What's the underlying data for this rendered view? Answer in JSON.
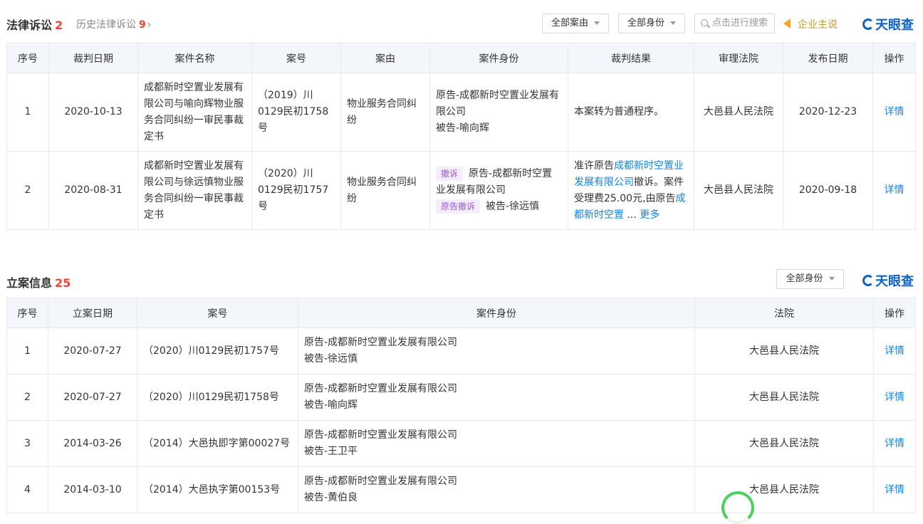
{
  "lawsuits": {
    "title": "法律诉讼",
    "count": "2",
    "history_label": "历史法律诉讼",
    "history_count": "9",
    "filter_cause": "全部案由",
    "filter_role": "全部身份",
    "search_placeholder": "点击进行搜索",
    "speak_label": "企业主说",
    "brand": "天眼查",
    "columns": [
      "序号",
      "裁判日期",
      "案件名称",
      "案号",
      "案由",
      "案件身份",
      "裁判结果",
      "审理法院",
      "发布日期",
      "操作"
    ],
    "rows": [
      {
        "no": "1",
        "date": "2020-10-13",
        "name": "成都新时空置业发展有限公司与喻向辉物业服务合同纠纷一审民事裁定书",
        "case_no": "（2019）川0129民初1758号",
        "cause": "物业服务合同纠纷",
        "role_line1": "原告-成都新时空置业发展有限公司",
        "role_line2": "被告-喻向辉",
        "result": "本案转为普通程序。",
        "court": "大邑县人民法院",
        "pub_date": "2020-12-23",
        "action": "详情"
      },
      {
        "no": "2",
        "date": "2020-08-31",
        "name": "成都新时空置业发展有限公司与徐远慎物业服务合同纠纷一审民事裁定书",
        "case_no": "（2020）川0129民初1757号",
        "cause": "物业服务合同纠纷",
        "tag1": "撤诉",
        "role_line1": "原告-成都新时空置业发展有限公司",
        "tag2": "原告撤诉",
        "role_line2": "被告-徐远慎",
        "result_pre": "准许原告",
        "result_link1": "成都新时空置业发展有限公司",
        "result_mid": "撤诉。案件受理费25.00元,由原告",
        "result_link2": "成都新时空置",
        "result_ellipsis": "...",
        "result_more": "更多",
        "court": "大邑县人民法院",
        "pub_date": "2020-09-18",
        "action": "详情"
      }
    ]
  },
  "filings": {
    "title": "立案信息",
    "count": "25",
    "filter_role": "全部身份",
    "brand": "天眼查",
    "columns": [
      "序号",
      "立案日期",
      "案号",
      "案件身份",
      "法院",
      "操作"
    ],
    "rows": [
      {
        "no": "1",
        "date": "2020-07-27",
        "case_no": "（2020）川0129民初1757号",
        "role_line1": "原告-成都新时空置业发展有限公司",
        "role_line2": "被告-徐远慎",
        "court": "大邑县人民法院",
        "action": "详情"
      },
      {
        "no": "2",
        "date": "2020-07-27",
        "case_no": "（2020）川0129民初1758号",
        "role_line1": "原告-成都新时空置业发展有限公司",
        "role_line2": "被告-喻向辉",
        "court": "大邑县人民法院",
        "action": "详情"
      },
      {
        "no": "3",
        "date": "2014-03-26",
        "case_no": "（2014）大邑执即字第00027号",
        "role_line1": "原告-成都新时空置业发展有限公司",
        "role_line2": "被告-王卫平",
        "court": "大邑县人民法院",
        "action": "详情"
      },
      {
        "no": "4",
        "date": "2014-03-10",
        "case_no": "（2014）大邑执字第00153号",
        "role_line1": "原告-成都新时空置业发展有限公司",
        "role_line2": "被告-黄伯良",
        "court": "大邑县人民法院",
        "action": "详情"
      }
    ]
  },
  "colors": {
    "accent": "#0f84e6",
    "count": "#f04134",
    "header_bg": "#f3f7fc",
    "brand": "#0f62c6"
  }
}
